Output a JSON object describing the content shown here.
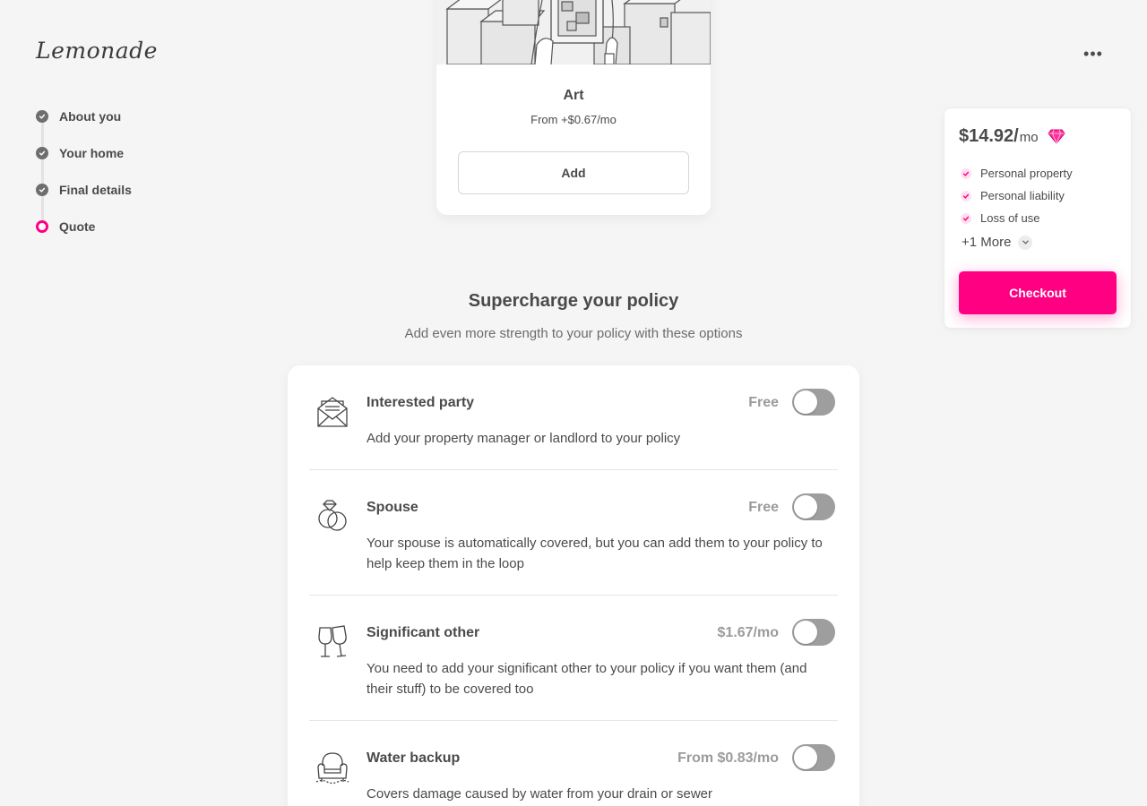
{
  "brand": {
    "logo_text": "Lemonade"
  },
  "header": {
    "more_label": "•••"
  },
  "steps": [
    {
      "label": "About you",
      "state": "done"
    },
    {
      "label": "Your home",
      "state": "done"
    },
    {
      "label": "Final details",
      "state": "done"
    },
    {
      "label": "Quote",
      "state": "active"
    }
  ],
  "art_card": {
    "title": "Art",
    "price": "From +$0.67/mo",
    "add_label": "Add"
  },
  "summary": {
    "price": "$14.92/",
    "per": "mo",
    "coverages": [
      "Personal property",
      "Personal liability",
      "Loss of use"
    ],
    "more_label": "+1 More",
    "checkout_label": "Checkout"
  },
  "section": {
    "title": "Supercharge your policy",
    "subtitle": "Add even more strength to your policy with these options"
  },
  "options": [
    {
      "title": "Interested party",
      "price": "Free",
      "desc": "Add your property manager or landlord to your policy",
      "icon": "envelope-icon",
      "enabled": false
    },
    {
      "title": "Spouse",
      "price": "Free",
      "desc": "Your spouse is automatically covered, but you can add them to your policy to help keep them in the loop",
      "icon": "rings-icon",
      "enabled": false
    },
    {
      "title": "Significant other",
      "price": "$1.67/mo",
      "desc": "You need to add your significant other to your policy if you want them (and their stuff) to be covered too",
      "icon": "wine-glasses-icon",
      "enabled": false
    },
    {
      "title": "Water backup",
      "price": "From $0.83/mo",
      "desc": "Covers damage caused by water from your drain or sewer",
      "icon": "armchair-icon",
      "enabled": false
    }
  ],
  "colors": {
    "accent": "#ff0083",
    "text": "#4a4a4a",
    "toggle_off": "#9e9e9e",
    "background": "#f5f5f5"
  }
}
